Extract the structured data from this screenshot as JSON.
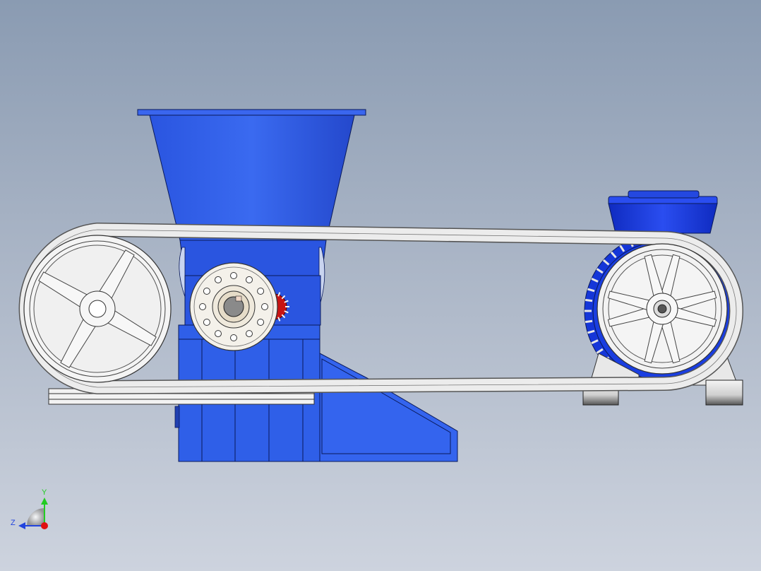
{
  "viewport": {
    "background_top": "#8a9bb2",
    "background_bottom": "#cdd3de"
  },
  "colors": {
    "body_blue": "#2f5fe8",
    "body_blue_dark": "#1f3fb0",
    "motor_blue": "#1536d8",
    "outline": "#0a1a5a",
    "belt": "#e8e8e8",
    "pulley": "#f2f2f2",
    "gear_red": "#c81414",
    "axis_y": "#22cc22",
    "axis_z": "#2244dd",
    "axis_origin": "#e01010"
  },
  "triad": {
    "y_label": "Y",
    "z_label": "Z"
  }
}
